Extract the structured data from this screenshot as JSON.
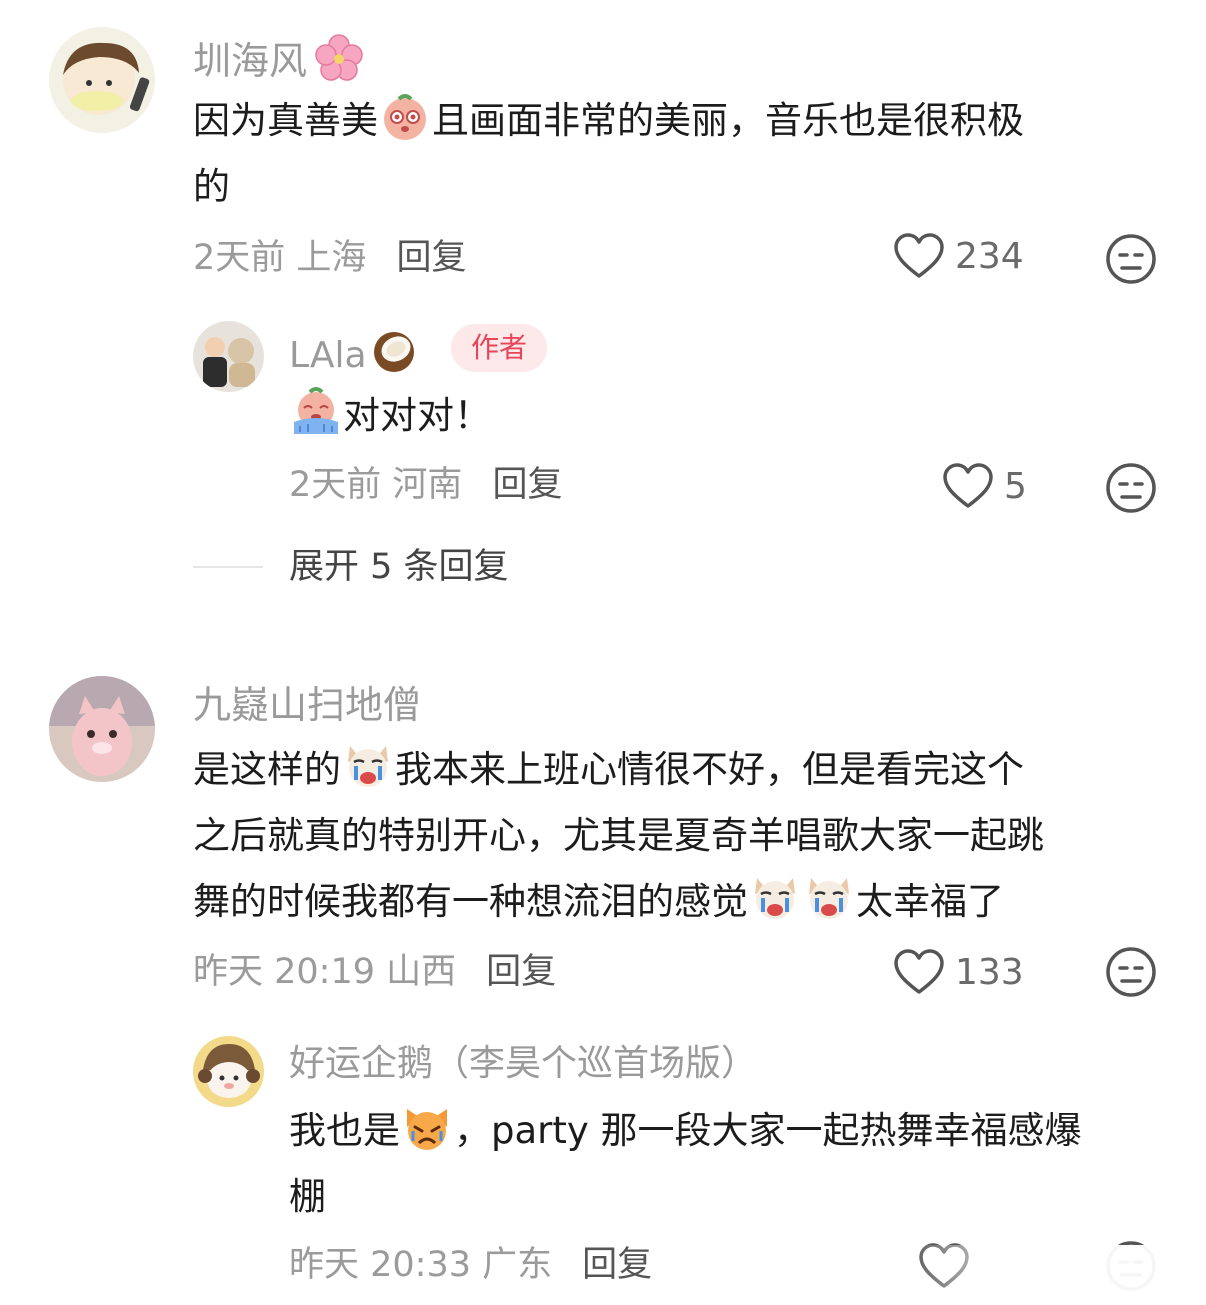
{
  "comments": [
    {
      "username": "圳海风",
      "text_part1": "因为真善美",
      "text_part2": "且画面非常的美丽，音乐也是很积极",
      "text_part3": "的",
      "time": "2天前",
      "location": "上海",
      "reply_label": "回复",
      "likes": "234",
      "replies": [
        {
          "username": "LAla",
          "badge": "作者",
          "text": "对对对！",
          "time": "2天前",
          "location": "河南",
          "reply_label": "回复",
          "likes": "5"
        }
      ],
      "expand_label": "展开 5 条回复"
    },
    {
      "username": "九嶷山扫地僧",
      "line1_a": "是这样的",
      "line1_b": "我本来上班心情很不好，但是看完这个",
      "line2": "之后就真的特别开心，尤其是夏奇羊唱歌大家一起跳",
      "line3_a": "舞的时候我都有一种想流泪的感觉",
      "line3_b": "太幸福了",
      "time": "昨天 20:19",
      "location": "山西",
      "reply_label": "回复",
      "likes": "133",
      "replies": [
        {
          "username": "好运企鹅（李昊个巡首场版）",
          "text_a": "我也是",
          "text_b": "，party 那一段大家一起热舞幸福感爆",
          "text_c": "棚",
          "time": "昨天 20:33",
          "location": "广东",
          "reply_label": "回复"
        }
      ]
    }
  ],
  "icons": {
    "like": "heart-outline-icon",
    "dislike": "meh-face-icon"
  }
}
